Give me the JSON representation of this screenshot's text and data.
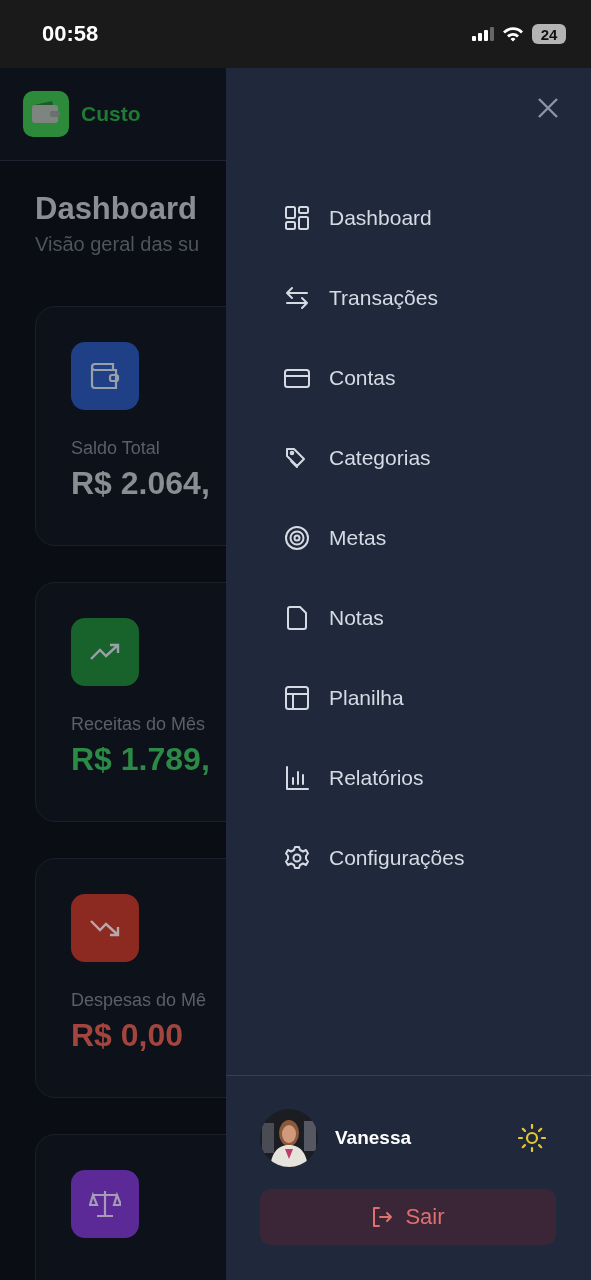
{
  "status_bar": {
    "time": "00:58",
    "battery": "24"
  },
  "header": {
    "app_name": "Custo"
  },
  "page": {
    "title": "Dashboard",
    "subtitle": "Visão geral das su"
  },
  "cards": [
    {
      "kind": "balance",
      "label": "Saldo Total",
      "value": "R$ 2.064,"
    },
    {
      "kind": "income",
      "label": "Receitas do Mês",
      "value": "R$ 1.789,"
    },
    {
      "kind": "expense",
      "label": "Despesas do Mê",
      "value": "R$ 0,00"
    },
    {
      "kind": "net"
    }
  ],
  "drawer": {
    "menu": [
      {
        "label": "Dashboard"
      },
      {
        "label": "Transações"
      },
      {
        "label": "Contas"
      },
      {
        "label": "Categorias"
      },
      {
        "label": "Metas"
      },
      {
        "label": "Notas"
      },
      {
        "label": "Planilha"
      },
      {
        "label": "Relatórios"
      },
      {
        "label": "Configurações"
      }
    ],
    "user": {
      "name": "Vanessa"
    },
    "logout": "Sair"
  }
}
